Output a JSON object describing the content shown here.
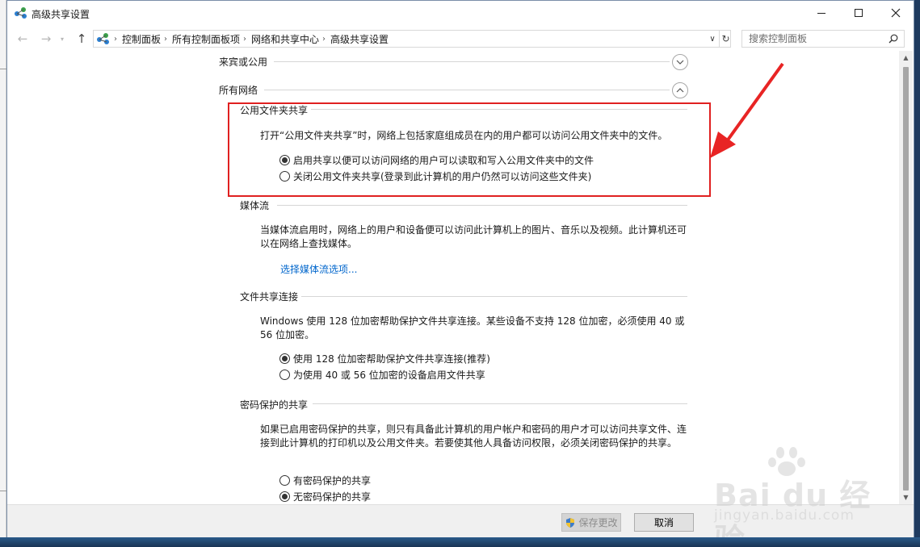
{
  "window": {
    "title": "高级共享设置"
  },
  "breadcrumb": [
    "控制面板",
    "所有控制面板项",
    "网络和共享中心",
    "高级共享设置"
  ],
  "search": {
    "placeholder": "搜索控制面板"
  },
  "groups": {
    "guest_public": {
      "label": "来宾或公用"
    },
    "all_networks": {
      "label": "所有网络"
    }
  },
  "public_folder": {
    "title": "公用文件夹共享",
    "description": "打开“公用文件夹共享”时，网络上包括家庭组成员在内的用户都可以访问公用文件夹中的文件。",
    "options": [
      {
        "label": "启用共享以便可以访问网络的用户可以读取和写入公用文件夹中的文件",
        "selected": true
      },
      {
        "label": "关闭公用文件夹共享(登录到此计算机的用户仍然可以访问这些文件夹)",
        "selected": false
      }
    ]
  },
  "media_streaming": {
    "title": "媒体流",
    "description": "当媒体流启用时，网络上的用户和设备便可以访问此计算机上的图片、音乐以及视频。此计算机还可以在网络上查找媒体。",
    "link": "选择媒体流选项..."
  },
  "file_sharing": {
    "title": "文件共享连接",
    "description": "Windows 使用 128 位加密帮助保护文件共享连接。某些设备不支持 128 位加密，必须使用 40 或 56 位加密。",
    "options": [
      {
        "label": "使用 128 位加密帮助保护文件共享连接(推荐)",
        "selected": true
      },
      {
        "label": "为使用 40 或 56 位加密的设备启用文件共享",
        "selected": false
      }
    ]
  },
  "password_sharing": {
    "title": "密码保护的共享",
    "description": "如果已启用密码保护的共享，则只有具备此计算机的用户帐户和密码的用户才可以访问共享文件、连接到此计算机的打印机以及公用文件夹。若要使其他人具备访问权限，必须关闭密码保护的共享。",
    "options": [
      {
        "label": "有密码保护的共享",
        "selected": false
      },
      {
        "label": "无密码保护的共享",
        "selected": true
      }
    ]
  },
  "footer": {
    "save_label": "保存更改",
    "cancel_label": "取消"
  },
  "watermark": {
    "main": "Bai du 经验",
    "sub": "jingyan.baidu.com"
  },
  "colors": {
    "highlight": "#e02020",
    "link": "#0066cc"
  }
}
